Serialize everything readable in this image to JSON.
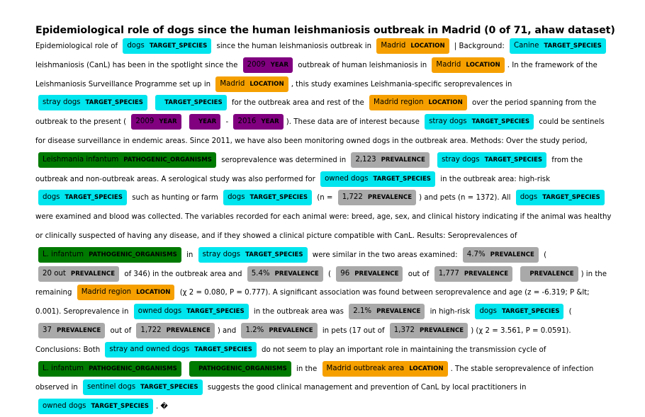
{
  "page": {
    "title": "Epidemiological role of dogs since the human leishmaniosis outbreak in Madrid (0 of 71, ahaw dataset)"
  },
  "colors": {
    "TARGET_SPECIES": "#00e5ee",
    "LOCATION": "#f5a000",
    "YEAR": "#800080",
    "PREVALENCE": "#a9a9a9",
    "PATHOGENIC_ORGANISMS": "#007a00"
  },
  "segments": [
    {
      "t": "Epidemiological role of "
    },
    {
      "e": "dogs",
      "l": "TARGET_SPECIES"
    },
    {
      "t": " since the human leishmaniosis outbreak in "
    },
    {
      "e": "Madrid",
      "l": "LOCATION"
    },
    {
      "t": " | Background: "
    },
    {
      "e": "Canine",
      "l": "TARGET_SPECIES"
    },
    {
      "t": " leishmaniosis (CanL) has been in the spotlight since the "
    },
    {
      "e": "2009",
      "l": "YEAR"
    },
    {
      "t": " outbreak of human leishmaniosis in "
    },
    {
      "e": "Madrid",
      "l": "LOCATION"
    },
    {
      "t": ". In the framework of the Leishmaniosis Surveillance Programme set up in "
    },
    {
      "e": "Madrid",
      "l": "LOCATION"
    },
    {
      "t": ", this study examines Leishmania-specific seroprevalences in "
    },
    {
      "e": "stray dogs",
      "l": "TARGET_SPECIES"
    },
    {
      "t": " "
    },
    {
      "e": "",
      "l": "TARGET_SPECIES"
    },
    {
      "t": " for the outbreak area and rest of the "
    },
    {
      "e": "Madrid region",
      "l": "LOCATION"
    },
    {
      "t": " over the period spanning from the outbreak to the present ( "
    },
    {
      "e": "2009",
      "l": "YEAR"
    },
    {
      "t": " "
    },
    {
      "e": "",
      "l": "YEAR"
    },
    {
      "t": " - "
    },
    {
      "e": "2016",
      "l": "YEAR"
    },
    {
      "t": "). These data are of interest because "
    },
    {
      "e": "stray dogs",
      "l": "TARGET_SPECIES"
    },
    {
      "t": " could be sentinels for disease surveillance in endemic areas. Since 2011, we have also been monitoring owned dogs in the outbreak area. Methods: Over the study period, "
    },
    {
      "e": "Leishmania infantum",
      "l": "PATHOGENIC_ORGANISMS"
    },
    {
      "t": " seroprevalence was determined in "
    },
    {
      "e": "2,123",
      "l": "PREVALENCE"
    },
    {
      "t": " "
    },
    {
      "e": "stray dogs",
      "l": "TARGET_SPECIES"
    },
    {
      "t": " from the outbreak and non-outbreak areas. A serological study was also performed for "
    },
    {
      "e": "owned dogs",
      "l": "TARGET_SPECIES"
    },
    {
      "t": " in the outbreak area: high-risk "
    },
    {
      "e": "dogs",
      "l": "TARGET_SPECIES"
    },
    {
      "t": " such as hunting or farm "
    },
    {
      "e": "dogs",
      "l": "TARGET_SPECIES"
    },
    {
      "t": " (n = "
    },
    {
      "e": "1,722",
      "l": "PREVALENCE"
    },
    {
      "t": ") and pets (n = 1372). All "
    },
    {
      "e": "dogs",
      "l": "TARGET_SPECIES"
    },
    {
      "t": " were examined and blood was collected. The variables recorded for each animal were: breed, age, sex, and clinical history indicating if the animal was healthy or clinically suspected of having any disease, and if they showed a clinical picture compatible with CanL. Results: Seroprevalences of "
    },
    {
      "e": "L. infantum",
      "l": "PATHOGENIC_ORGANISMS"
    },
    {
      "t": " in "
    },
    {
      "e": "stray dogs",
      "l": "TARGET_SPECIES"
    },
    {
      "t": " were similar in the two areas examined: "
    },
    {
      "e": "4.7%",
      "l": "PREVALENCE"
    },
    {
      "t": " ( "
    },
    {
      "e": "20 out",
      "l": "PREVALENCE"
    },
    {
      "t": " of 346) in the outbreak area and "
    },
    {
      "e": "5.4%",
      "l": "PREVALENCE"
    },
    {
      "t": " ( "
    },
    {
      "e": "96",
      "l": "PREVALENCE"
    },
    {
      "t": " out of "
    },
    {
      "e": "1,777",
      "l": "PREVALENCE"
    },
    {
      "t": " "
    },
    {
      "e": "",
      "l": "PREVALENCE"
    },
    {
      "t": ") in the remaining "
    },
    {
      "e": "Madrid region",
      "l": "LOCATION"
    },
    {
      "t": " (χ 2 = 0.080, P = 0.777). A significant association was found between seroprevalence and age (z = -6.319; P &lt; 0.001). Seroprevalence in "
    },
    {
      "e": "owned dogs",
      "l": "TARGET_SPECIES"
    },
    {
      "t": " in the outbreak area was "
    },
    {
      "e": "2.1%",
      "l": "PREVALENCE"
    },
    {
      "t": " in high-risk "
    },
    {
      "e": "dogs",
      "l": "TARGET_SPECIES"
    },
    {
      "t": " ( "
    },
    {
      "e": "37",
      "l": "PREVALENCE"
    },
    {
      "t": " out of "
    },
    {
      "e": "1,722",
      "l": "PREVALENCE"
    },
    {
      "t": ") and "
    },
    {
      "e": "1.2%",
      "l": "PREVALENCE"
    },
    {
      "t": " in pets (17 out of "
    },
    {
      "e": "1,372",
      "l": "PREVALENCE"
    },
    {
      "t": ") (χ 2 = 3.561, P = 0.0591). Conclusions: Both "
    },
    {
      "e": "stray and owned dogs",
      "l": "TARGET_SPECIES"
    },
    {
      "t": " do not seem to play an important role in maintaining the transmission cycle of "
    },
    {
      "e": "L. infantum",
      "l": "PATHOGENIC_ORGANISMS"
    },
    {
      "t": " "
    },
    {
      "e": "",
      "l": "PATHOGENIC_ORGANISMS"
    },
    {
      "t": " in the "
    },
    {
      "e": "Madrid outbreak area",
      "l": "LOCATION"
    },
    {
      "t": ". The stable seroprevalence of infection observed in "
    },
    {
      "e": "sentinel dogs",
      "l": "TARGET_SPECIES"
    },
    {
      "t": " suggests the good clinical management and prevention of CanL by local practitioners in "
    },
    {
      "e": "owned dogs",
      "l": "TARGET_SPECIES"
    },
    {
      "t": ". �"
    }
  ]
}
